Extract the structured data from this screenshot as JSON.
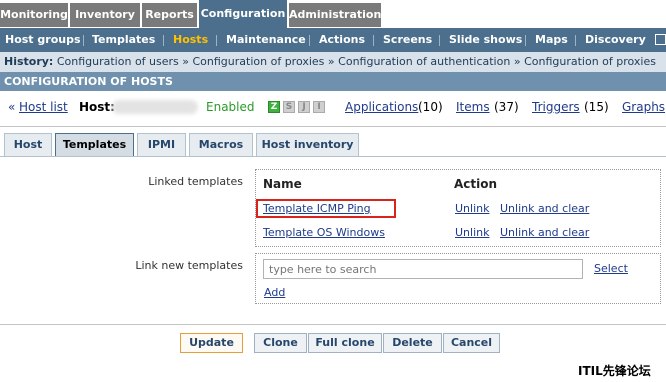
{
  "top_menu": [
    {
      "label": "Monitoring",
      "active": false
    },
    {
      "label": "Inventory",
      "active": false
    },
    {
      "label": "Reports",
      "active": false
    },
    {
      "label": "Configuration",
      "active": true
    },
    {
      "label": "Administration",
      "active": false
    }
  ],
  "sub_menu": [
    {
      "label": "Host groups",
      "active": false
    },
    {
      "label": "Templates",
      "active": false
    },
    {
      "label": "Hosts",
      "active": true
    },
    {
      "label": "Maintenance",
      "active": false
    },
    {
      "label": "Actions",
      "active": false
    },
    {
      "label": "Screens",
      "active": false
    },
    {
      "label": "Slide shows",
      "active": false
    },
    {
      "label": "Maps",
      "active": false
    },
    {
      "label": "Discovery",
      "active": false
    }
  ],
  "history": {
    "label": "History:",
    "items": [
      "Configuration of users",
      "Configuration of proxies",
      "Configuration of authentication",
      "Configuration of proxies"
    ],
    "separator": "»"
  },
  "page_title": "CONFIGURATION OF HOSTS",
  "host_line": {
    "back_prefix": "«",
    "host_list": "Host list",
    "host_label": "Host:",
    "status": "Enabled",
    "badges": [
      "Z",
      "S",
      "J",
      "I"
    ],
    "applications": "Applications",
    "applications_count": "(10)",
    "items": "Items",
    "items_count": "(37)",
    "triggers": "Triggers",
    "triggers_count": "(15)",
    "graphs": "Graphs"
  },
  "tabs": [
    {
      "label": "Host",
      "active": false
    },
    {
      "label": "Templates",
      "active": true
    },
    {
      "label": "IPMI",
      "active": false
    },
    {
      "label": "Macros",
      "active": false
    },
    {
      "label": "Host inventory",
      "active": false
    }
  ],
  "form": {
    "linked_templates_label": "Linked templates",
    "col_name": "Name",
    "col_action": "Action",
    "templates": [
      {
        "name": "Template ICMP Ping",
        "unlink": "Unlink",
        "unlink_clear": "Unlink and clear"
      },
      {
        "name": "Template OS Windows",
        "unlink": "Unlink",
        "unlink_clear": "Unlink and clear"
      }
    ],
    "link_new_label": "Link new templates",
    "search_placeholder": "type here to search",
    "select": "Select",
    "add": "Add"
  },
  "buttons": {
    "update": "Update",
    "clone": "Clone",
    "full_clone": "Full clone",
    "delete": "Delete",
    "cancel": "Cancel"
  },
  "watermark": "ITIL先锋论坛",
  "colors": {
    "menu_blue": "#4c6f8e",
    "active_submenu": "#ffc100",
    "highlight_red": "#d9241b",
    "enabled_green": "#2a9a2a"
  }
}
